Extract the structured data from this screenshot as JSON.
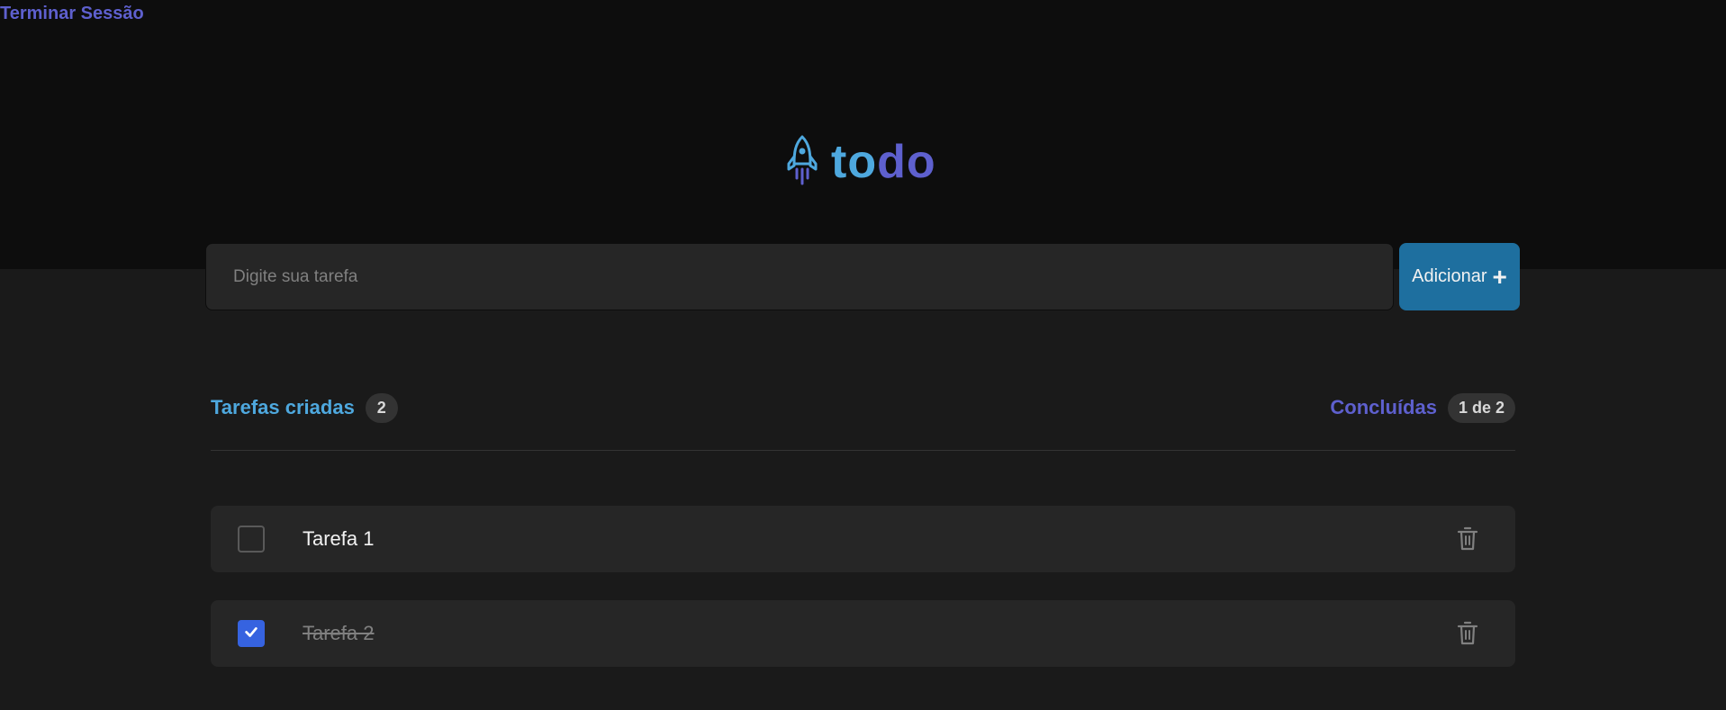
{
  "header": {
    "logout_label": "Terminar Sessão",
    "logo": {
      "text_part1": "to",
      "text_part2": "do",
      "icon": "rocket-icon"
    }
  },
  "form": {
    "placeholder": "Digite sua tarefa",
    "value": "",
    "add_label": "Adicionar",
    "add_icon": "plus-icon"
  },
  "stats": {
    "created_label": "Tarefas criadas",
    "created_count": "2",
    "done_label": "Concluídas",
    "done_count": "1 de 2"
  },
  "tasks": [
    {
      "label": "Tarefa 1",
      "completed": false
    },
    {
      "label": "Tarefa 2",
      "completed": true
    }
  ],
  "colors": {
    "blue": "#4ea8de",
    "purple": "#5e60ce",
    "button": "#1e6f9f",
    "checkbox_checked": "#3663e0",
    "header_bg": "#0d0d0d",
    "page_bg": "#1a1a1a",
    "card_bg": "#262626"
  }
}
